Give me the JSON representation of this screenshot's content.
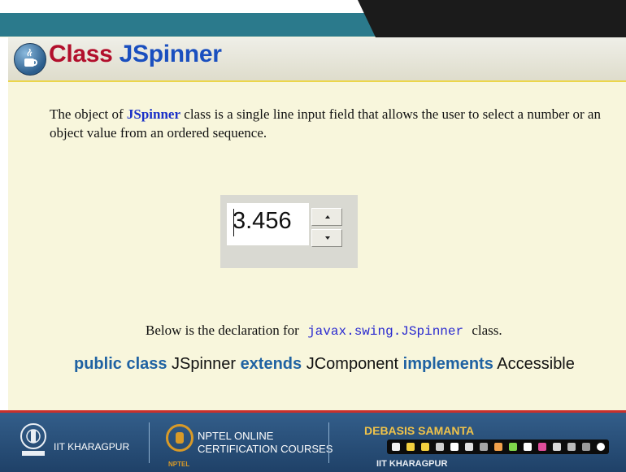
{
  "slide": {
    "title_word1": "Class",
    "title_word2": "JSpinner",
    "description_before": "The object of ",
    "description_highlight": "JSpinner",
    "description_after": " class is a single line input field that allows the user to select a number or an object value from an ordered sequence."
  },
  "spinner": {
    "value": "3.456",
    "up_icon": "triangle-up",
    "down_icon": "triangle-down"
  },
  "declaration": {
    "before": "Below is the declaration for",
    "class_name": "javax.swing.JSpinner",
    "after": "class."
  },
  "signature": {
    "kw1": "public class",
    "name": " JSpinner ",
    "kw2": "extends",
    "parent": " JComponent ",
    "kw3": "implements",
    "iface": " Accessible"
  },
  "footer": {
    "iit": "IIT KHARAGPUR",
    "nptel_line1": "NPTEL ONLINE",
    "nptel_line2": "CERTIFICATION COURSES",
    "nptel_small": "NPTEL",
    "presenter": "DEBASIS SAMANTA",
    "presenter_org": "IIT KHARAGPUR"
  },
  "colors": {
    "title_red": "#b20f2c",
    "title_blue": "#1a4fbf",
    "background": "#f8f6dc",
    "footer_blue": "#2a5481"
  }
}
